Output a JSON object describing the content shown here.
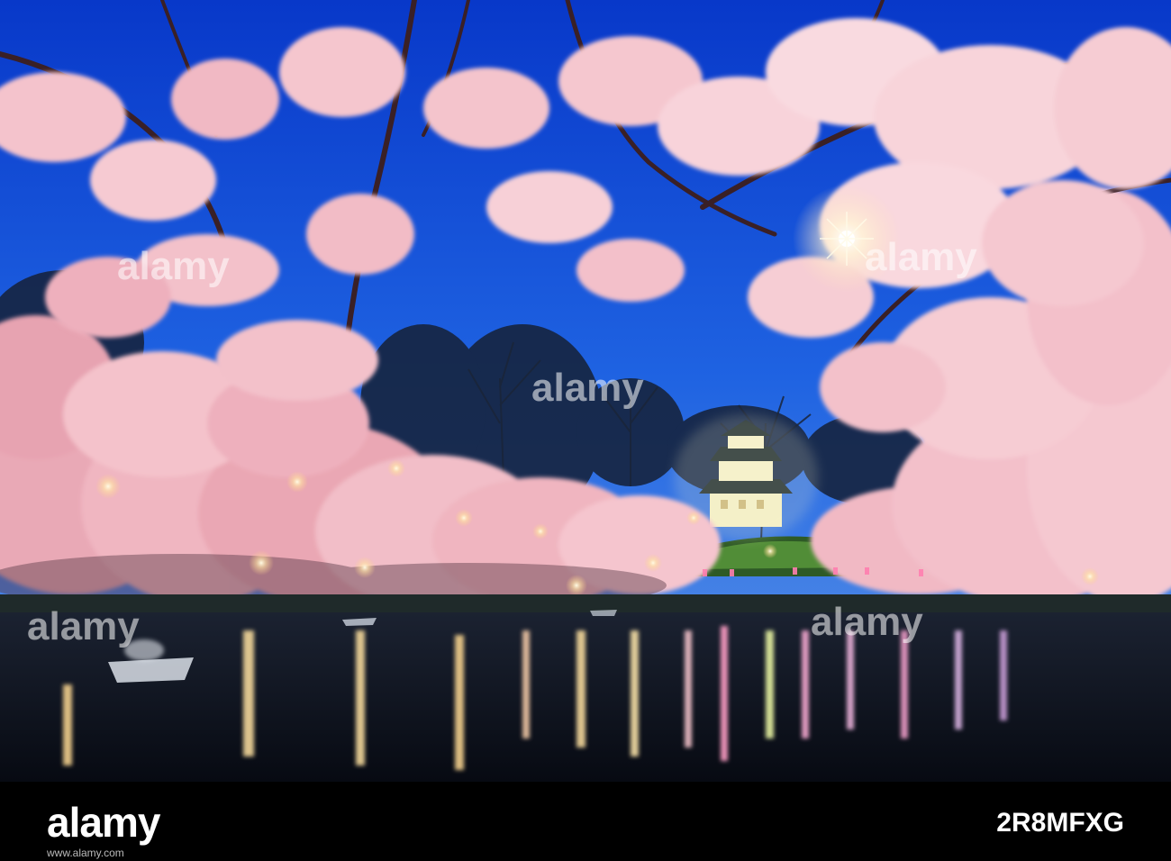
{
  "footer": {
    "brand": "alamy",
    "image_id": "2R8MFXG",
    "url": "www.alamy.com"
  },
  "watermark": {
    "text": "alamy"
  },
  "colors": {
    "sky_top": "#0a3fd6",
    "sky_bottom": "#3a7ce8",
    "blossom": "#f3b9c3",
    "blossom_light": "#ffd9df",
    "water": "#0d1420",
    "lantern": "#ffe9a8"
  }
}
